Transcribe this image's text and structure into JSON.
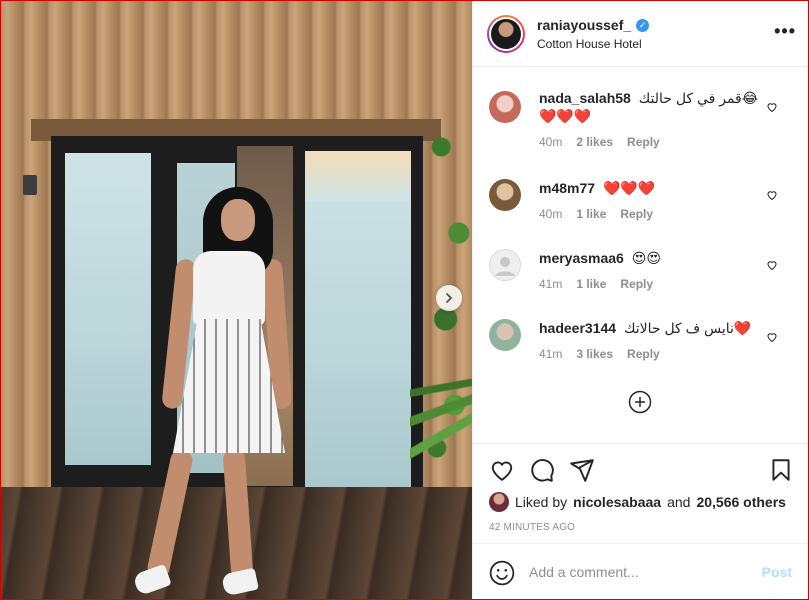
{
  "colors": {
    "accent": "#0095f6",
    "verified": "#3897f0",
    "heart_red": "#ed4956",
    "muted": "#8e8e8e",
    "post_disabled": "#b2dffc"
  },
  "post": {
    "photo_icon": "chevron-right-icon"
  },
  "header": {
    "username": "raniayoussef_",
    "verified_icon": "verified-badge-icon",
    "location": "Cotton House Hotel",
    "more_icon": "more-options-icon",
    "more_label": "•••"
  },
  "comments": [
    {
      "user": "nada_salah58",
      "text": "قمر في كل حالتك😂",
      "text2": "❤️❤️❤️",
      "time": "40m",
      "likes": "2 likes",
      "reply": "Reply",
      "avatar_color": "#e9c3bd"
    },
    {
      "user": "m48m77",
      "text": "❤️❤️❤️",
      "text2": "",
      "time": "40m",
      "likes": "1 like",
      "reply": "Reply",
      "avatar_color": "#c8a27a"
    },
    {
      "user": "meryasmaa6",
      "text": "😍😍",
      "text2": "",
      "time": "41m",
      "likes": "1 like",
      "reply": "Reply",
      "avatar_color": "#dbdbdb"
    },
    {
      "user": "hadeer3144",
      "text": "نايس ف كل حالاتك❤️",
      "text2": "",
      "time": "41m",
      "likes": "3 likes",
      "reply": "Reply",
      "avatar_color": "#b9cfc1"
    }
  ],
  "actions": {
    "like_icon": "heart-icon",
    "comment_icon": "comment-icon",
    "share_icon": "share-icon",
    "save_icon": "bookmark-icon",
    "liked_prefix": "Liked by",
    "liked_user": "nicolesabaaa",
    "liked_and": "and",
    "liked_others": "20,566 others",
    "timestamp": "42 MINUTES AGO"
  },
  "add_comment": {
    "emoji_icon": "emoji-icon",
    "placeholder": "Add a comment...",
    "post_label": "Post"
  }
}
